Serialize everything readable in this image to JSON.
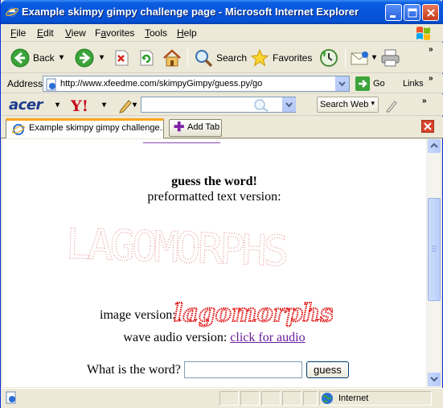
{
  "window": {
    "title": "Example skimpy gimpy challenge page - Microsoft Internet Explorer"
  },
  "menu": [
    {
      "label": "File",
      "key": "F",
      "rest": "ile"
    },
    {
      "label": "Edit",
      "key": "E",
      "rest": "dit"
    },
    {
      "label": "View",
      "key": "V",
      "rest": "iew"
    },
    {
      "label": "Favorites",
      "key": "a",
      "pre": "F",
      "rest": "vorites"
    },
    {
      "label": "Tools",
      "key": "T",
      "rest": "ools"
    },
    {
      "label": "Help",
      "key": "H",
      "rest": "elp"
    }
  ],
  "toolbar": {
    "back_label": "Back",
    "search_label": "Search",
    "favorites_label": "Favorites"
  },
  "address": {
    "label": "Address",
    "url": "http://www.xfeedme.com/skimpyGimpy/guess.py/go",
    "go_label": "Go",
    "links_label": "Links"
  },
  "acerbar": {
    "logo": "acer",
    "search_placeholder": "",
    "search_web_label": "Search Web"
  },
  "tabs": {
    "active_tab_label": "Example skimpy gimpy challenge...",
    "add_tab_label": "Add Tab"
  },
  "page": {
    "heading": "guess the word!",
    "preformatted_label": "preformatted text version:",
    "ascii_word": "LAGOMORPHS",
    "image_label": "image version:",
    "captcha_word": "lagomorphs",
    "audio_label": "wave audio version:",
    "audio_link": "click for audio",
    "question_label": "What is the word?",
    "answer_value": "",
    "guess_button": "guess"
  },
  "status": {
    "zone_label": "Internet"
  },
  "colors": {
    "titlebar": "#0855dd",
    "link_visited": "#6a1b9a",
    "ascii_art": "#e89a9a",
    "captcha": "#e01010",
    "tab_accent": "#f9a61b"
  }
}
